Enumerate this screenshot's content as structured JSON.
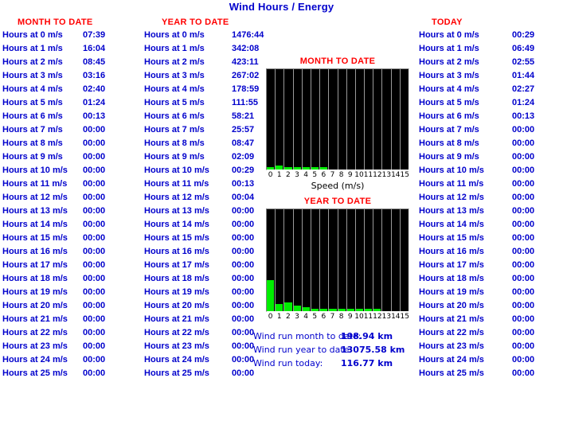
{
  "page": {
    "title": "Wind Hours / Energy"
  },
  "columns": {
    "month_to_date": {
      "heading": "MONTH TO DATE",
      "rows": [
        {
          "label": "Hours at 0 m/s",
          "value": "07:39"
        },
        {
          "label": "Hours at 1 m/s",
          "value": "16:04"
        },
        {
          "label": "Hours at 2 m/s",
          "value": "08:45"
        },
        {
          "label": "Hours at 3 m/s",
          "value": "03:16"
        },
        {
          "label": "Hours at 4 m/s",
          "value": "02:40"
        },
        {
          "label": "Hours at 5 m/s",
          "value": "01:24"
        },
        {
          "label": "Hours at 6 m/s",
          "value": "00:13"
        },
        {
          "label": "Hours at 7 m/s",
          "value": "00:00"
        },
        {
          "label": "Hours at 8 m/s",
          "value": "00:00"
        },
        {
          "label": "Hours at 9 m/s",
          "value": "00:00"
        },
        {
          "label": "Hours at 10 m/s",
          "value": "00:00"
        },
        {
          "label": "Hours at 11 m/s",
          "value": "00:00"
        },
        {
          "label": "Hours at 12 m/s",
          "value": "00:00"
        },
        {
          "label": "Hours at 13 m/s",
          "value": "00:00"
        },
        {
          "label": "Hours at 14 m/s",
          "value": "00:00"
        },
        {
          "label": "Hours at 15 m/s",
          "value": "00:00"
        },
        {
          "label": "Hours at 16 m/s",
          "value": "00:00"
        },
        {
          "label": "Hours at 17 m/s",
          "value": "00:00"
        },
        {
          "label": "Hours at 18 m/s",
          "value": "00:00"
        },
        {
          "label": "Hours at 19 m/s",
          "value": "00:00"
        },
        {
          "label": "Hours at 20 m/s",
          "value": "00:00"
        },
        {
          "label": "Hours at 21 m/s",
          "value": "00:00"
        },
        {
          "label": "Hours at 22 m/s",
          "value": "00:00"
        },
        {
          "label": "Hours at 23 m/s",
          "value": "00:00"
        },
        {
          "label": "Hours at 24 m/s",
          "value": "00:00"
        },
        {
          "label": "Hours at 25 m/s",
          "value": "00:00"
        }
      ]
    },
    "year_to_date": {
      "heading": "YEAR TO DATE",
      "rows": [
        {
          "label": "Hours at 0 m/s",
          "value": "1476:44"
        },
        {
          "label": "Hours at 1 m/s",
          "value": "342:08"
        },
        {
          "label": "Hours at 2 m/s",
          "value": "423:11"
        },
        {
          "label": "Hours at 3 m/s",
          "value": "267:02"
        },
        {
          "label": "Hours at 4 m/s",
          "value": "178:59"
        },
        {
          "label": "Hours at 5 m/s",
          "value": "111:55"
        },
        {
          "label": "Hours at 6 m/s",
          "value": "58:21"
        },
        {
          "label": "Hours at 7 m/s",
          "value": "25:57"
        },
        {
          "label": "Hours at 8 m/s",
          "value": "08:47"
        },
        {
          "label": "Hours at 9 m/s",
          "value": "02:09"
        },
        {
          "label": "Hours at 10 m/s",
          "value": "00:29"
        },
        {
          "label": "Hours at 11 m/s",
          "value": "00:13"
        },
        {
          "label": "Hours at 12 m/s",
          "value": "00:04"
        },
        {
          "label": "Hours at 13 m/s",
          "value": "00:00"
        },
        {
          "label": "Hours at 14 m/s",
          "value": "00:00"
        },
        {
          "label": "Hours at 15 m/s",
          "value": "00:00"
        },
        {
          "label": "Hours at 16 m/s",
          "value": "00:00"
        },
        {
          "label": "Hours at 17 m/s",
          "value": "00:00"
        },
        {
          "label": "Hours at 18 m/s",
          "value": "00:00"
        },
        {
          "label": "Hours at 19 m/s",
          "value": "00:00"
        },
        {
          "label": "Hours at 20 m/s",
          "value": "00:00"
        },
        {
          "label": "Hours at 21 m/s",
          "value": "00:00"
        },
        {
          "label": "Hours at 22 m/s",
          "value": "00:00"
        },
        {
          "label": "Hours at 23 m/s",
          "value": "00:00"
        },
        {
          "label": "Hours at 24 m/s",
          "value": "00:00"
        },
        {
          "label": "Hours at 25 m/s",
          "value": "00:00"
        }
      ]
    },
    "today": {
      "heading": "TODAY",
      "rows": [
        {
          "label": "Hours at 0 m/s",
          "value": "00:29"
        },
        {
          "label": "Hours at 1 m/s",
          "value": "06:49"
        },
        {
          "label": "Hours at 2 m/s",
          "value": "02:55"
        },
        {
          "label": "Hours at 3 m/s",
          "value": "01:44"
        },
        {
          "label": "Hours at 4 m/s",
          "value": "02:27"
        },
        {
          "label": "Hours at 5 m/s",
          "value": "01:24"
        },
        {
          "label": "Hours at 6 m/s",
          "value": "00:13"
        },
        {
          "label": "Hours at 7 m/s",
          "value": "00:00"
        },
        {
          "label": "Hours at 8 m/s",
          "value": "00:00"
        },
        {
          "label": "Hours at 9 m/s",
          "value": "00:00"
        },
        {
          "label": "Hours at 10 m/s",
          "value": "00:00"
        },
        {
          "label": "Hours at 11 m/s",
          "value": "00:00"
        },
        {
          "label": "Hours at 12 m/s",
          "value": "00:00"
        },
        {
          "label": "Hours at 13 m/s",
          "value": "00:00"
        },
        {
          "label": "Hours at 14 m/s",
          "value": "00:00"
        },
        {
          "label": "Hours at 15 m/s",
          "value": "00:00"
        },
        {
          "label": "Hours at 16 m/s",
          "value": "00:00"
        },
        {
          "label": "Hours at 17 m/s",
          "value": "00:00"
        },
        {
          "label": "Hours at 18 m/s",
          "value": "00:00"
        },
        {
          "label": "Hours at 19 m/s",
          "value": "00:00"
        },
        {
          "label": "Hours at 20 m/s",
          "value": "00:00"
        },
        {
          "label": "Hours at 21 m/s",
          "value": "00:00"
        },
        {
          "label": "Hours at 22 m/s",
          "value": "00:00"
        },
        {
          "label": "Hours at 23 m/s",
          "value": "00:00"
        },
        {
          "label": "Hours at 24 m/s",
          "value": "00:00"
        },
        {
          "label": "Hours at 25 m/s",
          "value": "00:00"
        }
      ]
    }
  },
  "wind_run": {
    "rows": [
      {
        "label": "Wind run month to date:",
        "value": "198.94 km"
      },
      {
        "label": "Wind run year to date:",
        "value": "13075.58 km"
      },
      {
        "label": "Wind run today:",
        "value": "116.77 km"
      }
    ]
  },
  "colors": {
    "title": "#0000cc",
    "heading": "#ff0000",
    "value": "#0000cc",
    "bar": "#00ee00",
    "plot_bg": "#000000",
    "gridline": "#9a9a9a"
  },
  "chart_data": [
    {
      "type": "bar",
      "name": "month-to-date",
      "title": "MONTH TO DATE",
      "xlabel": "Speed (m/s)",
      "ylabel": "",
      "categories": [
        "0",
        "1",
        "2",
        "3",
        "4",
        "5",
        "6",
        "7",
        "8",
        "9",
        "10",
        "11",
        "12",
        "13",
        "14",
        "15"
      ],
      "values": [
        7.65,
        16.07,
        8.75,
        3.27,
        2.67,
        1.4,
        0.22,
        0,
        0,
        0,
        0,
        0,
        0,
        0,
        0,
        0
      ],
      "value_unit": "hours",
      "ylim": [
        0,
        420
      ],
      "grid": true,
      "legend": false
    },
    {
      "type": "bar",
      "name": "year-to-date",
      "title": "YEAR TO DATE",
      "xlabel": "",
      "ylabel": "",
      "categories": [
        "0",
        "1",
        "2",
        "3",
        "4",
        "5",
        "6",
        "7",
        "8",
        "9",
        "10",
        "11",
        "12",
        "13",
        "14",
        "15"
      ],
      "values": [
        1476.73,
        342.13,
        423.18,
        267.03,
        178.98,
        111.92,
        58.35,
        25.95,
        8.78,
        2.15,
        0.48,
        0.22,
        0.07,
        0,
        0,
        0
      ],
      "value_unit": "hours",
      "ylim": [
        0,
        4900
      ],
      "grid": true,
      "legend": false
    }
  ]
}
